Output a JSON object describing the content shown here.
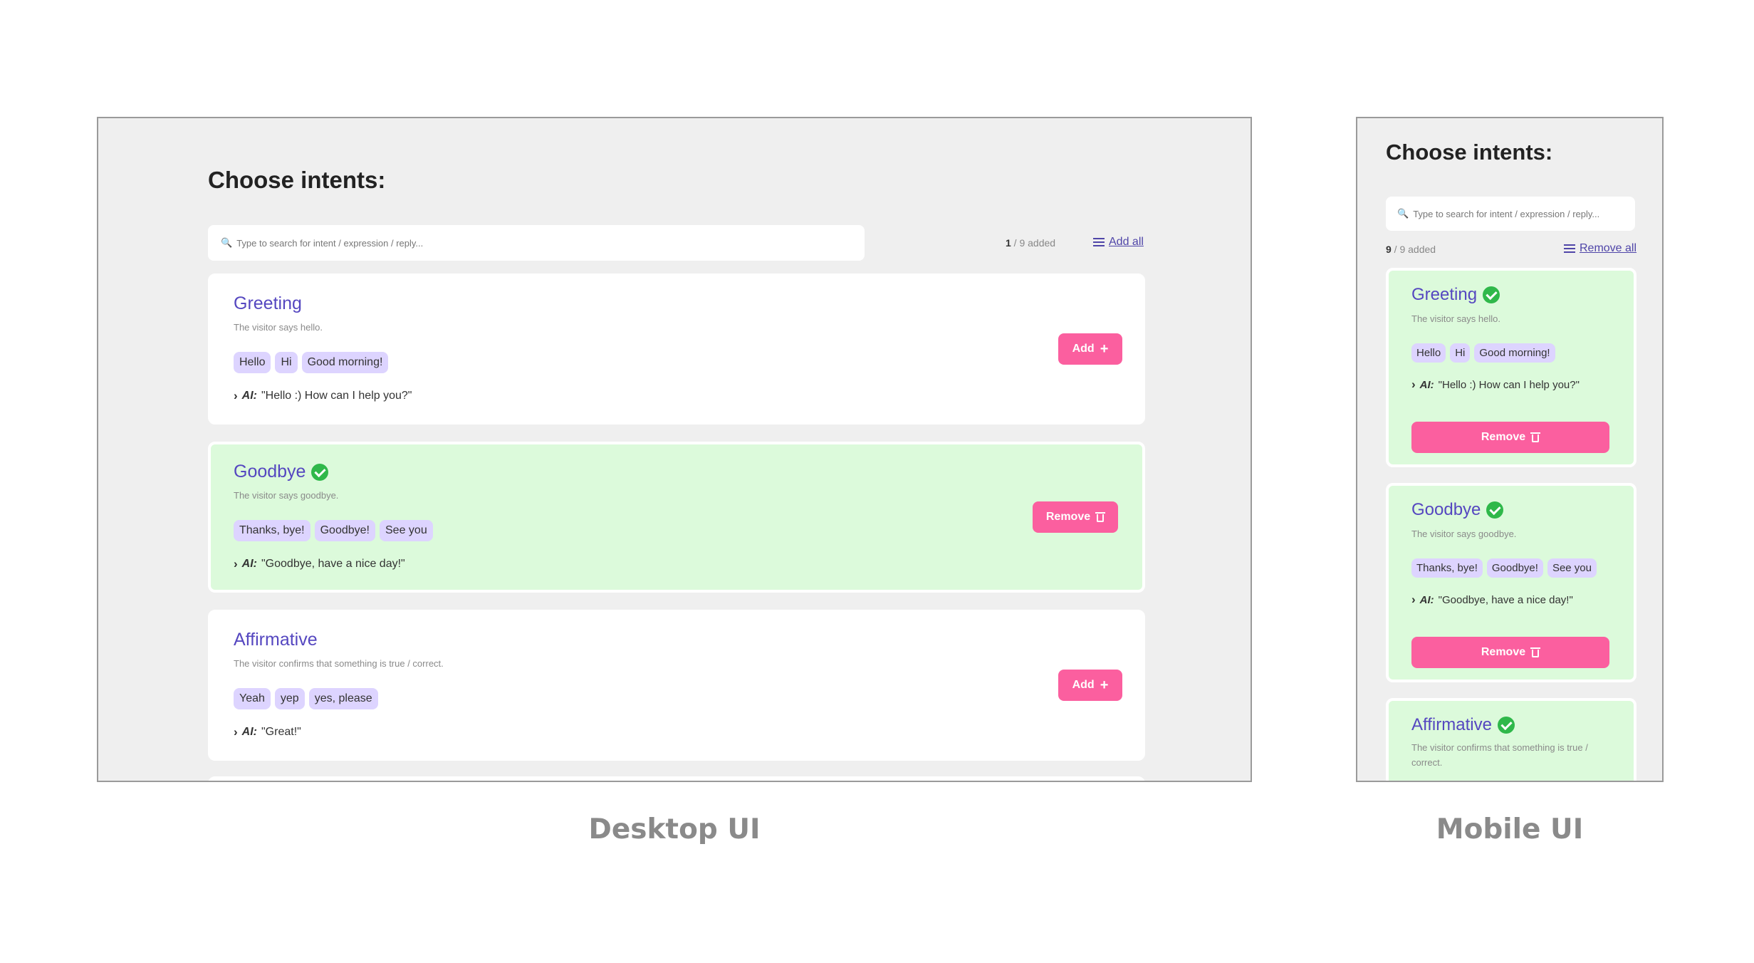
{
  "desktop": {
    "title": "Choose intents:",
    "search_placeholder": "Type to search for intent / expression / reply...",
    "count_added": "1",
    "count_total": " / 9 added",
    "bulk_action": "Add all",
    "cards": [
      {
        "name": "Greeting",
        "description": "The visitor says hello.",
        "expressions": [
          "Hello",
          "Hi",
          "Good morning!"
        ],
        "ai_label": "AI:",
        "reply": "\"Hello :) How can I help you?\"",
        "added": false,
        "button": "Add"
      },
      {
        "name": "Goodbye",
        "description": "The visitor says goodbye.",
        "expressions": [
          "Thanks, bye!",
          "Goodbye!",
          "See you"
        ],
        "ai_label": "AI:",
        "reply": "\"Goodbye, have a nice day!\"",
        "added": true,
        "button": "Remove"
      },
      {
        "name": "Affirmative",
        "description": "The visitor confirms that something is true / correct.",
        "expressions": [
          "Yeah",
          "yep",
          "yes, please"
        ],
        "ai_label": "AI:",
        "reply": "\"Great!\"",
        "added": false,
        "button": "Add"
      }
    ]
  },
  "mobile": {
    "title": "Choose intents:",
    "search_placeholder": "Type to search for intent / expression / reply...",
    "count_added": "9",
    "count_total": " / 9 added",
    "bulk_action": "Remove all",
    "cards": [
      {
        "name": "Greeting",
        "description": "The visitor says hello.",
        "expressions": [
          "Hello",
          "Hi",
          "Good morning!"
        ],
        "ai_label": "AI:",
        "reply": "\"Hello :) How can I help you?\"",
        "button": "Remove"
      },
      {
        "name": "Goodbye",
        "description": "The visitor says goodbye.",
        "expressions": [
          "Thanks, bye!",
          "Goodbye!",
          "See you"
        ],
        "ai_label": "AI:",
        "reply": "\"Goodbye, have a nice day!\"",
        "button": "Remove"
      },
      {
        "name": "Affirmative",
        "description": "The visitor confirms that something is true / correct."
      }
    ]
  },
  "captions": {
    "desktop": "Desktop UI",
    "mobile": "Mobile UI"
  },
  "colors": {
    "accent_button": "#fb5f9f",
    "intent_name": "#5547c0",
    "chip_bg": "#ddd4ff",
    "added_card_bg": "#dcfadb",
    "check": "#2fb84a",
    "panel_bg": "#efefef"
  },
  "icons": {
    "search": "magnifier-icon",
    "bulk": "list-icon",
    "added": "check-circle-icon",
    "add": "plus-icon",
    "remove": "trash-icon",
    "reply": "chevron-right-icon"
  }
}
